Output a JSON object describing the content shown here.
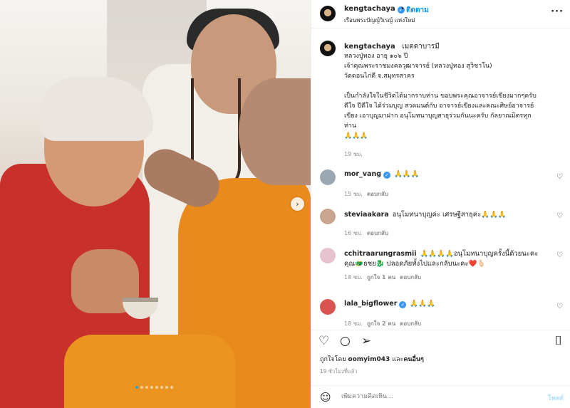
{
  "header": {
    "username": "kengtachaya",
    "verified_glyph": "✓",
    "separator": "•",
    "follow_label": "ติดตาม",
    "location": "เรือนพระปัญญ์วิเรญ์ แห่งใหม่",
    "more_glyph": "···"
  },
  "caption": {
    "username": "kengtachaya",
    "title": "เมตตาบารมี",
    "lines": [
      "หลวงปู่ทอง อายุ ๑๐๖ ปี",
      "เจ้าคุณพระราชมงคลวุฒาจารย์ (หลวงปู่ทอง สุวิชาโน)",
      "วัดดอนไก่ดี จ.สมุทรสาคร",
      "",
      "เป็นกำลังใจในชีวิตได้มากราบท่าน ขอบพระคุณอาจารย์เขียงมากๆครับ",
      "ดีใจ ปีดีใจ ได้ร่วมบุญ สวดมนต์กับ อาจารย์เขียงและคณะศิษย์อาจารย์",
      "เขียง เอาบุญมาฝาก อนุโมทนาบุญสาธุร่วมกันนะครับ กัลยาณมิตรทุก",
      "ท่าน",
      "🙏🙏🙏"
    ],
    "time": "19 ชม."
  },
  "comments": [
    {
      "username": "mor_vang",
      "verified": true,
      "text": "🙏🙏🙏",
      "time": "15 ชม.",
      "likes": "",
      "reply": "ตอบกลับ",
      "avatar_color": "#9aa7b0"
    },
    {
      "username": "steviaakara",
      "verified": false,
      "text": "อนุโมทนาบุญค่ะ เศรษฐีสาธุค่ะ🙏🙏🙏",
      "time": "16 ชม.",
      "likes": "",
      "reply": "ตอบกลับ",
      "avatar_color": "#c9a58f"
    },
    {
      "username": "cchitraarungrasmii",
      "verified": false,
      "text": "🙏🙏🙏🙏อนุโมทนาบุญครั้งนี้ด้วยนะคะ",
      "text2": "คุณ🐲ธชย🐉 ปลอดภัยทั้งไปและกลับนะคะ❤️🫰🏻",
      "time": "18 ชม.",
      "likes": "ถูกใจ 1 คน",
      "reply": "ตอบกลับ",
      "avatar_color": "#e7c3d0"
    },
    {
      "username": "lala_bigflower",
      "verified": true,
      "text": "🙏🙏🙏",
      "time": "18 ชม.",
      "likes": "ถูกใจ 2 คน",
      "reply": "ตอบกลับ",
      "avatar_color": "#d9534f"
    }
  ],
  "actions": {
    "like_glyph": "♡",
    "comment_glyph": "○",
    "share_glyph": "➢",
    "save_glyph": "⌷"
  },
  "likes": {
    "prefix": "ถูกใจโดย",
    "user": "oomyim043",
    "suffix": "และ",
    "others": "คนอื่นๆ"
  },
  "post_date": "19 ชั่วโมงที่แล้ว",
  "add_comment": {
    "emoji_glyph": "☺",
    "placeholder": "เพิ่มความคิดเห็น...",
    "post_label": "โพสต์"
  },
  "carousel": {
    "next_glyph": "›",
    "total_slides": 8,
    "active_slide": 1
  },
  "colors": {
    "link_blue": "#0095f6",
    "verified_blue": "#3897f0",
    "robe_orange": "#e88a1c"
  }
}
